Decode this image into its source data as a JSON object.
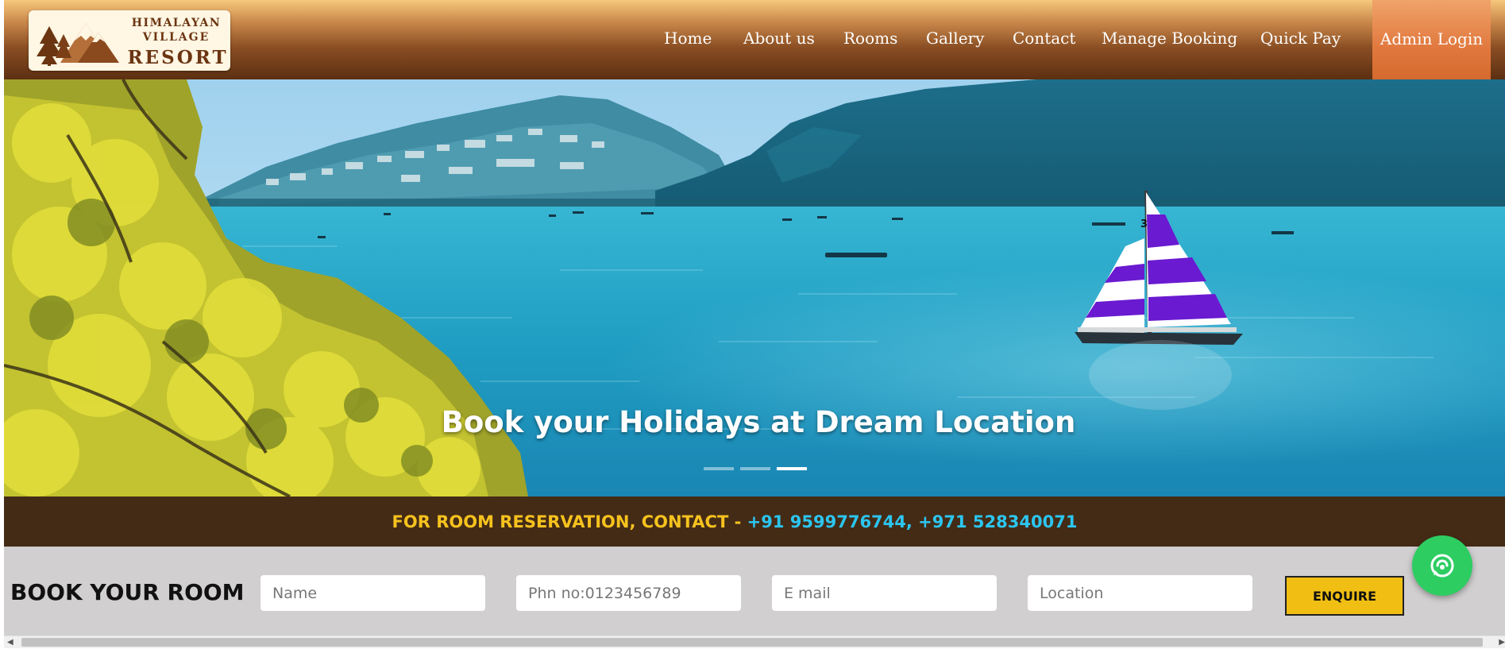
{
  "logo": {
    "line1": "HIMALAYAN",
    "line2": "VILLAGE",
    "line3": "RESORT"
  },
  "nav": {
    "items": [
      {
        "label": "Home"
      },
      {
        "label": "About us"
      },
      {
        "label": "Rooms"
      },
      {
        "label": "Gallery"
      },
      {
        "label": "Contact"
      },
      {
        "label": "Manage Booking"
      },
      {
        "label": "Quick Pay"
      }
    ],
    "admin_label": "Admin Login"
  },
  "hero": {
    "title": "Book your Holidays at Dream Location",
    "slides": 3,
    "active_slide": 3,
    "sail_number": "3"
  },
  "reservation": {
    "label": "FOR ROOM RESERVATION, CONTACT - ",
    "phones": "+91 9599776744, +971 528340071"
  },
  "booking": {
    "title": "BOOK YOUR ROOM",
    "fields": {
      "name_placeholder": "Name",
      "phone_placeholder": "Phn no:0123456789",
      "email_placeholder": "E mail",
      "location_placeholder": "Location"
    },
    "button_label": "ENQUIRE"
  },
  "icons": {
    "chat": "whatsapp-chat-icon",
    "scroll_left": "arrow-left-icon",
    "scroll_right": "arrow-right-icon"
  },
  "colors": {
    "header_dark": "#5c2f12",
    "admin_orange": "#e1793f",
    "reservation_bar": "#442b16",
    "reservation_label": "#f6c21e",
    "reservation_phones": "#2cc6f0",
    "enquire_button": "#f1bf13",
    "chat_green": "#2dcd62"
  }
}
